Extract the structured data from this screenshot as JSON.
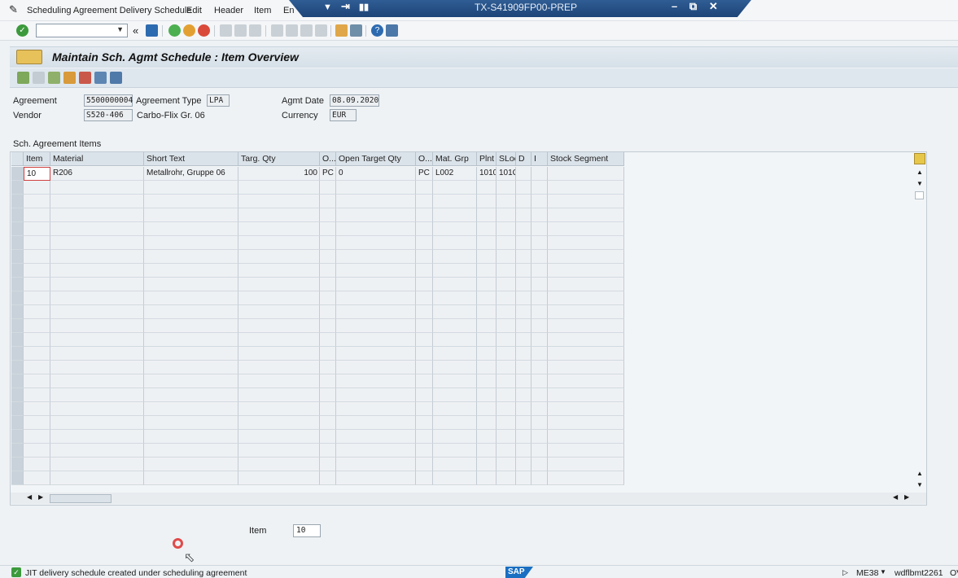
{
  "menu": {
    "items": [
      "Scheduling Agreement Delivery Schedule",
      "Edit",
      "Header",
      "Item",
      "En"
    ]
  },
  "window": {
    "title": "TX-S41909FP00-PREP"
  },
  "page": {
    "title": "Maintain Sch. Agmt Schedule : Item Overview"
  },
  "header": {
    "agreement_label": "Agreement",
    "agreement_value": "5500000004",
    "agreement_type_label": "Agreement Type",
    "agreement_type_value": "LPA",
    "agmt_date_label": "Agmt Date",
    "agmt_date_value": "08.09.2020",
    "vendor_label": "Vendor",
    "vendor_value": "S520-406",
    "vendor_name": "Carbo-Flix Gr. 06",
    "currency_label": "Currency",
    "currency_value": "EUR"
  },
  "table": {
    "title": "Sch. Agreement Items",
    "columns": [
      "Item",
      "Material",
      "Short Text",
      "Targ. Qty",
      "O...",
      "Open Target Qty",
      "O...",
      "Mat. Grp",
      "Plnt",
      "SLoc",
      "D",
      "I",
      "Stock Segment"
    ],
    "rows": [
      {
        "item": "10",
        "material": "R206",
        "short_text": "Metallrohr, Gruppe 06",
        "targ_qty": "100",
        "o1": "PC",
        "open_target_qty": "0",
        "o2": "PC",
        "mat_grp": "L002",
        "plnt": "1010",
        "sloc": "101C",
        "d": "",
        "i": "",
        "stock_segment": ""
      }
    ]
  },
  "footer": {
    "item_label": "Item",
    "item_value": "10"
  },
  "status": {
    "message": "JIT delivery schedule  created under scheduling agreement",
    "sap": "SAP",
    "transaction": "ME38",
    "user": "wdflbmt2261",
    "extra": "OV"
  },
  "colors": {
    "accent": "#1d4478",
    "ok": "#3c9a3c",
    "cursor": "#e04a4a"
  }
}
